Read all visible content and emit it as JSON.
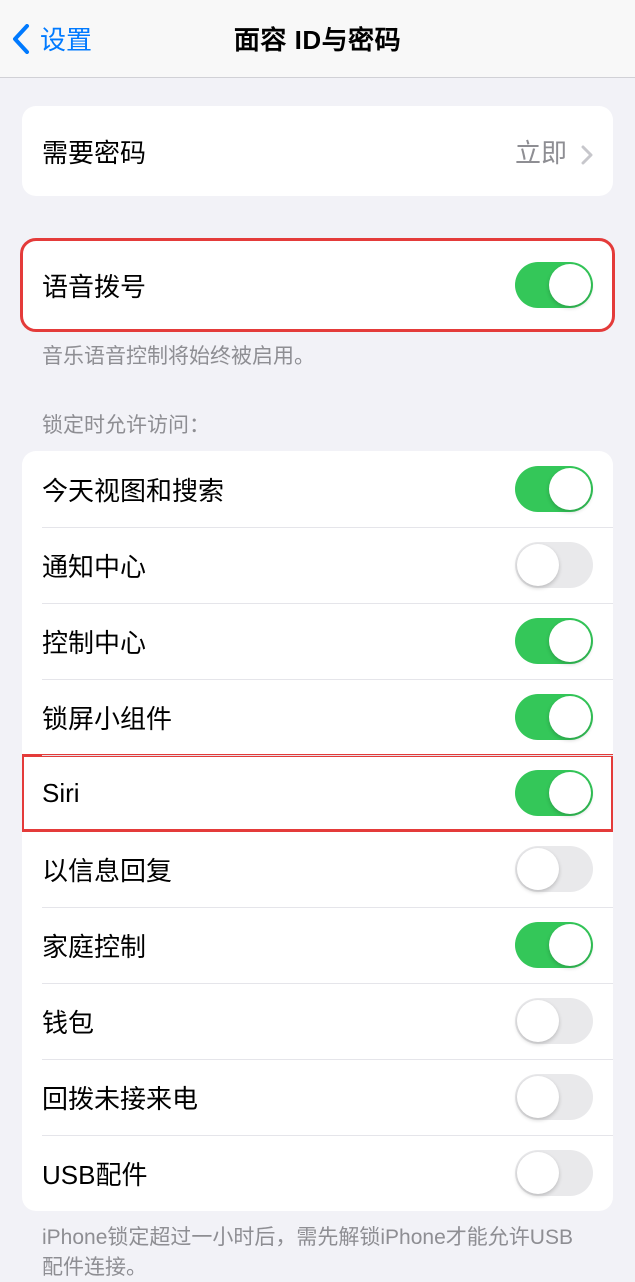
{
  "nav": {
    "back_label": "设置",
    "title": "面容 ID与密码"
  },
  "passcode_group": {
    "require_passcode_label": "需要密码",
    "require_passcode_value": "立即"
  },
  "voice_dial": {
    "label": "语音拨号",
    "on": true,
    "footer": "音乐语音控制将始终被启用。"
  },
  "lock_access": {
    "header": "锁定时允许访问：",
    "items": [
      {
        "label": "今天视图和搜索",
        "on": true
      },
      {
        "label": "通知中心",
        "on": false
      },
      {
        "label": "控制中心",
        "on": true
      },
      {
        "label": "锁屏小组件",
        "on": true
      },
      {
        "label": "Siri",
        "on": true,
        "highlighted": true
      },
      {
        "label": "以信息回复",
        "on": false
      },
      {
        "label": "家庭控制",
        "on": true
      },
      {
        "label": "钱包",
        "on": false
      },
      {
        "label": "回拨未接来电",
        "on": false
      },
      {
        "label": "USB配件",
        "on": false
      }
    ],
    "footer": "iPhone锁定超过一小时后，需先解锁iPhone才能允许USB配件连接。"
  }
}
